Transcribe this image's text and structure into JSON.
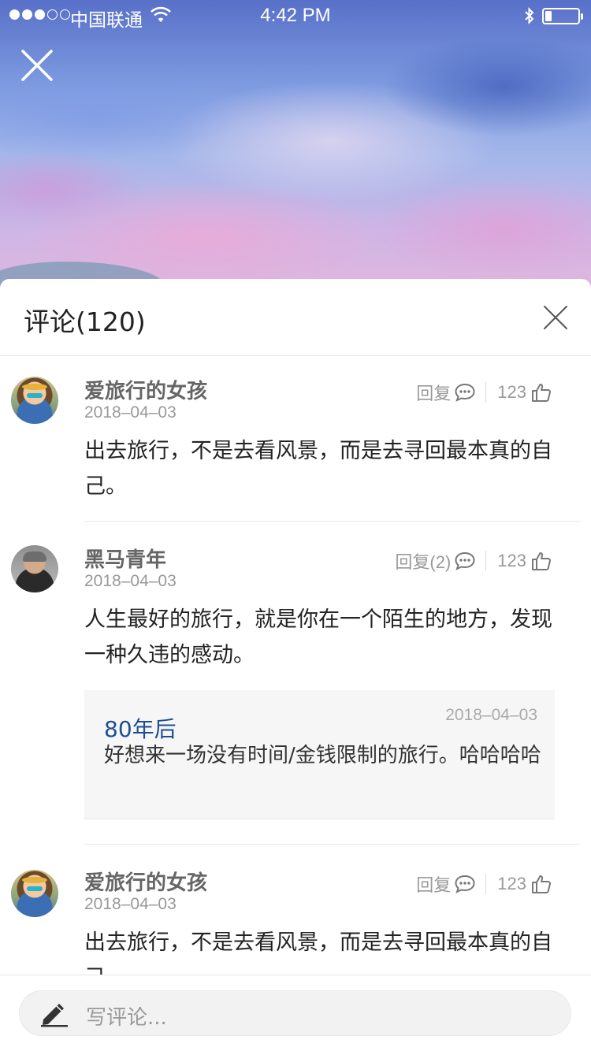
{
  "status_bar": {
    "carrier": "中国联通",
    "time": "4:42 PM",
    "signal_bars_filled": 3,
    "signal_bars_total": 5,
    "battery_level": 0.2
  },
  "colors": {
    "reply_name": "#1e4d94",
    "text_primary": "#222222",
    "text_secondary": "#999999"
  },
  "icons": {
    "close": "close-icon",
    "reply": "comment-bubble-icon",
    "like": "thumbs-up-icon",
    "compose": "pencil-icon"
  },
  "panel": {
    "title": "评论(120)"
  },
  "comments": [
    {
      "user": "爱旅行的女孩",
      "date": "2018–04–03",
      "reply_label": "回复",
      "likes": "123",
      "text": "出去旅行，不是去看风景，而是去寻回最本真的自己。"
    },
    {
      "user": "黑马青年",
      "date": "2018–04–03",
      "reply_label": "回复(2)",
      "likes": "123",
      "text": "人生最好的旅行，就是你在一个陌生的地方，发现一种久违的感动。",
      "reply": {
        "user": "80年后",
        "date": "2018–04–03",
        "text": "好想来一场没有时间/金钱限制的旅行。哈哈哈哈"
      }
    },
    {
      "user": "爱旅行的女孩",
      "date": "2018–04–03",
      "reply_label": "回复",
      "likes": "123",
      "text": "出去旅行，不是去看风景，而是去寻回最本真的自己。"
    }
  ],
  "composer": {
    "placeholder": "写评论..."
  }
}
